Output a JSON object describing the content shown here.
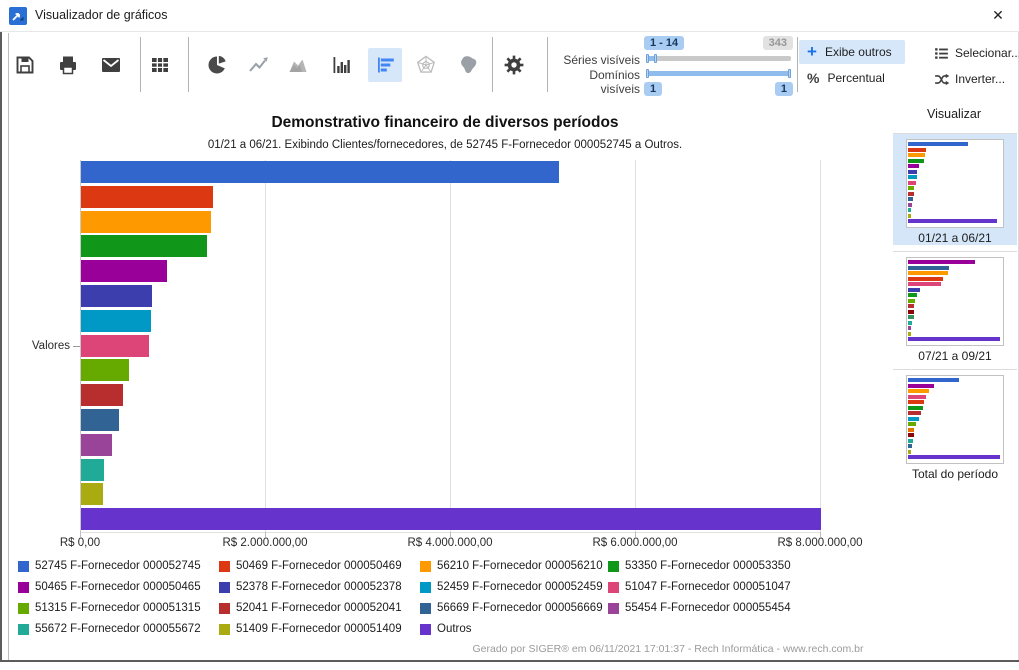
{
  "window": {
    "title": "Visualizador de gráficos",
    "close_glyph": "✕"
  },
  "toolbar": {
    "sliders": {
      "series_label": "Séries visíveis",
      "domains_label": "Domínios visíveis",
      "series_range_badge": "1 - 14",
      "series_total_badge": "343",
      "domains_left_badge": "1",
      "domains_right_badge": "1"
    },
    "buttons": {
      "exibe_outros": "Exibe outros",
      "percentual": "Percentual",
      "selecionar": "Selecionar...",
      "inverter": "Inverter...",
      "plus_glyph": "+",
      "percent_glyph": "%"
    }
  },
  "chart_data": {
    "type": "bar",
    "orientation": "horizontal",
    "title": "Demonstrativo financeiro de diversos períodos",
    "subtitle": "01/21 a 06/21. Exibindo Clientes/fornecedores, de 52745 F-Fornecedor 000052745 a Outros.",
    "ylabel": "Valores",
    "xlim": [
      0,
      8000000
    ],
    "grid": true,
    "legend_position": "bottom",
    "xtick_values": [
      0,
      2000000,
      4000000,
      6000000,
      8000000
    ],
    "xtick_labels": [
      "R$ 0,00",
      "R$ 2.000.000,00",
      "R$ 4.000.000,00",
      "R$ 6.000.000,00",
      "R$ 8.000.000,00"
    ],
    "bars": [
      {
        "label": "52745 F-Fornecedor 000052745",
        "color": "#3366CC",
        "value": 5170000
      },
      {
        "label": "50469 F-Fornecedor 000050469",
        "color": "#DC3912",
        "value": 1430000
      },
      {
        "label": "56210 F-Fornecedor 000056210",
        "color": "#FF9900",
        "value": 1400000
      },
      {
        "label": "53350 F-Fornecedor 000053350",
        "color": "#109618",
        "value": 1360000
      },
      {
        "label": "50465 F-Fornecedor 000050465",
        "color": "#990099",
        "value": 930000
      },
      {
        "label": "52378 F-Fornecedor 000052378",
        "color": "#3B3EAC",
        "value": 770000
      },
      {
        "label": "52459 F-Fornecedor 000052459",
        "color": "#0099C6",
        "value": 760000
      },
      {
        "label": "51047 F-Fornecedor 000051047",
        "color": "#DD4477",
        "value": 740000
      },
      {
        "label": "51315 F-Fornecedor 000051315",
        "color": "#66AA00",
        "value": 520000
      },
      {
        "label": "52041 F-Fornecedor 000052041",
        "color": "#B82E2E",
        "value": 450000
      },
      {
        "label": "56669 F-Fornecedor 000056669",
        "color": "#316395",
        "value": 410000
      },
      {
        "label": "55454 F-Fornecedor 000055454",
        "color": "#994499",
        "value": 330000
      },
      {
        "label": "55672 F-Fornecedor 000055672",
        "color": "#22AA99",
        "value": 250000
      },
      {
        "label": "51409 F-Fornecedor 000051409",
        "color": "#AAAA11",
        "value": 240000
      },
      {
        "label": "Outros",
        "color": "#6633CC",
        "value": 8000000
      }
    ]
  },
  "sidebar": {
    "title": "Visualizar",
    "thumbnails": [
      {
        "label": "01/21 a 06/21",
        "selected": true,
        "bars": [
          {
            "c": "#3366CC",
            "w": 0.65
          },
          {
            "c": "#DC3912",
            "w": 0.2
          },
          {
            "c": "#FF9900",
            "w": 0.18
          },
          {
            "c": "#109618",
            "w": 0.17
          },
          {
            "c": "#990099",
            "w": 0.12
          },
          {
            "c": "#3B3EAC",
            "w": 0.1
          },
          {
            "c": "#0099C6",
            "w": 0.1
          },
          {
            "c": "#DD4477",
            "w": 0.09
          },
          {
            "c": "#66AA00",
            "w": 0.07
          },
          {
            "c": "#B82E2E",
            "w": 0.06
          },
          {
            "c": "#316395",
            "w": 0.05
          },
          {
            "c": "#994499",
            "w": 0.04
          },
          {
            "c": "#22AA99",
            "w": 0.03
          },
          {
            "c": "#AAAA11",
            "w": 0.03
          },
          {
            "c": "#6633CC",
            "w": 0.97
          }
        ]
      },
      {
        "label": "07/21 a 09/21",
        "selected": false,
        "bars": [
          {
            "c": "#990099",
            "w": 0.73
          },
          {
            "c": "#316395",
            "w": 0.45
          },
          {
            "c": "#FF9900",
            "w": 0.43
          },
          {
            "c": "#DC3912",
            "w": 0.38
          },
          {
            "c": "#DD4477",
            "w": 0.36
          },
          {
            "c": "#3B3EAC",
            "w": 0.13
          },
          {
            "c": "#109618",
            "w": 0.1
          },
          {
            "c": "#66AA00",
            "w": 0.08
          },
          {
            "c": "#B82E2E",
            "w": 0.07
          },
          {
            "c": "#8B0707",
            "w": 0.06
          },
          {
            "c": "#329262",
            "w": 0.06
          },
          {
            "c": "#22AA99",
            "w": 0.04
          },
          {
            "c": "#994499",
            "w": 0.03
          },
          {
            "c": "#AAAA11",
            "w": 0.03
          },
          {
            "c": "#6633CC",
            "w": 1.0
          }
        ]
      },
      {
        "label": "Total do período",
        "selected": false,
        "bars": [
          {
            "c": "#3366CC",
            "w": 0.55
          },
          {
            "c": "#990099",
            "w": 0.28
          },
          {
            "c": "#FF9900",
            "w": 0.23
          },
          {
            "c": "#DD4477",
            "w": 0.2
          },
          {
            "c": "#DC3912",
            "w": 0.17
          },
          {
            "c": "#109618",
            "w": 0.16
          },
          {
            "c": "#B82E2E",
            "w": 0.14
          },
          {
            "c": "#0099C6",
            "w": 0.12
          },
          {
            "c": "#66AA00",
            "w": 0.09
          },
          {
            "c": "#E67300",
            "w": 0.07
          },
          {
            "c": "#8B0707",
            "w": 0.06
          },
          {
            "c": "#22AA99",
            "w": 0.05
          },
          {
            "c": "#316395",
            "w": 0.04
          },
          {
            "c": "#AAAA11",
            "w": 0.03
          },
          {
            "c": "#6633CC",
            "w": 1.0
          }
        ]
      }
    ]
  },
  "footer": "Gerado por SIGER® em 06/11/2021 17:01:37 - Rech Informática - www.rech.com.br"
}
